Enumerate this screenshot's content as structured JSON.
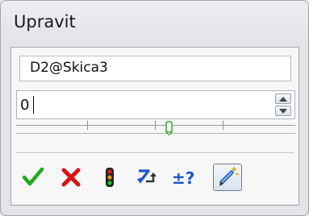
{
  "window": {
    "title": "Upravit"
  },
  "dimension": {
    "name": "D2@Skica3",
    "value": "0"
  },
  "toolbar": {
    "icons": [
      "checkmark-icon",
      "cancel-x-icon",
      "traffic-light-icon",
      "rebuild-arrow-icon",
      "tolerance-icon",
      "pencil-icon"
    ],
    "tolerance_label": "±?"
  },
  "colors": {
    "check": "#22aa22",
    "cancel": "#dd1111",
    "arrow": "#1a56c4",
    "thumb": "#2ea82e"
  }
}
